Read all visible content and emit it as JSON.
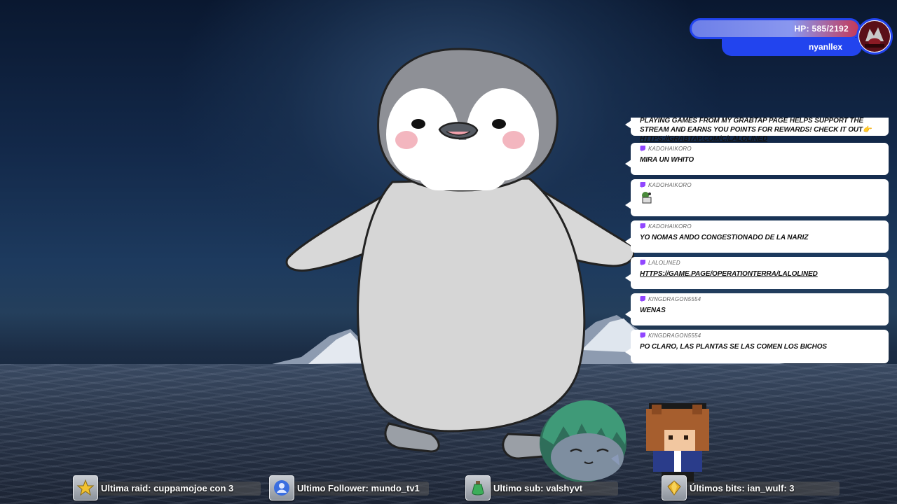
{
  "hp_widget": {
    "hp_text": "HP: 585/2192",
    "hp_current": 585,
    "hp_max": 2192,
    "username": "nyanllex",
    "accent_color": "#2244ee"
  },
  "chat": {
    "messages": [
      {
        "user": "",
        "text": "PLAYING GAMES FROM MY GRABTAP PAGE HELPS SUPPORT THE STREAM AND EARNS YOU POINTS FOR REWARDS! CHECK IT OUT",
        "emoji": "👉",
        "link": "HTTPS://GRABTAP.COM/C/LALOLINED"
      },
      {
        "user": "KADOHAIKORO",
        "text": "MIRA UN WHITO",
        "link": ""
      },
      {
        "user": "KADOHAIKORO",
        "text": "",
        "emote": "small-character-emote",
        "link": ""
      },
      {
        "user": "KADOHAIKORO",
        "text": "YO NOMAS ANDO CONGESTIONADO DE LA NARIZ",
        "link": ""
      },
      {
        "user": "LALOLINED",
        "text": "",
        "link": "HTTPS://GAME.PAGE/OPERATIONTERRA/LALOLINED"
      },
      {
        "user": "KINGDRAGON5554",
        "text": "WENAS",
        "link": ""
      },
      {
        "user": "KINGDRAGON5554",
        "text": "PO CLARO, LAS PLANTAS SE LAS COMEN LOS BICHOS",
        "link": ""
      }
    ],
    "platform_icon": "twitch-icon",
    "platform_color": "#9146ff"
  },
  "events": {
    "raid": {
      "label": "Ultima raid: cuppamojoe con 3",
      "icon": "star-icon"
    },
    "follower": {
      "label": "Ultimo Follower: mundo_tv1",
      "icon": "person-icon"
    },
    "sub": {
      "label": "Ultimo sub: valshyvt",
      "icon": "potion-icon"
    },
    "bits": {
      "label": "Últimos bits: ian_wulf: 3",
      "icon": "gem-icon"
    }
  }
}
